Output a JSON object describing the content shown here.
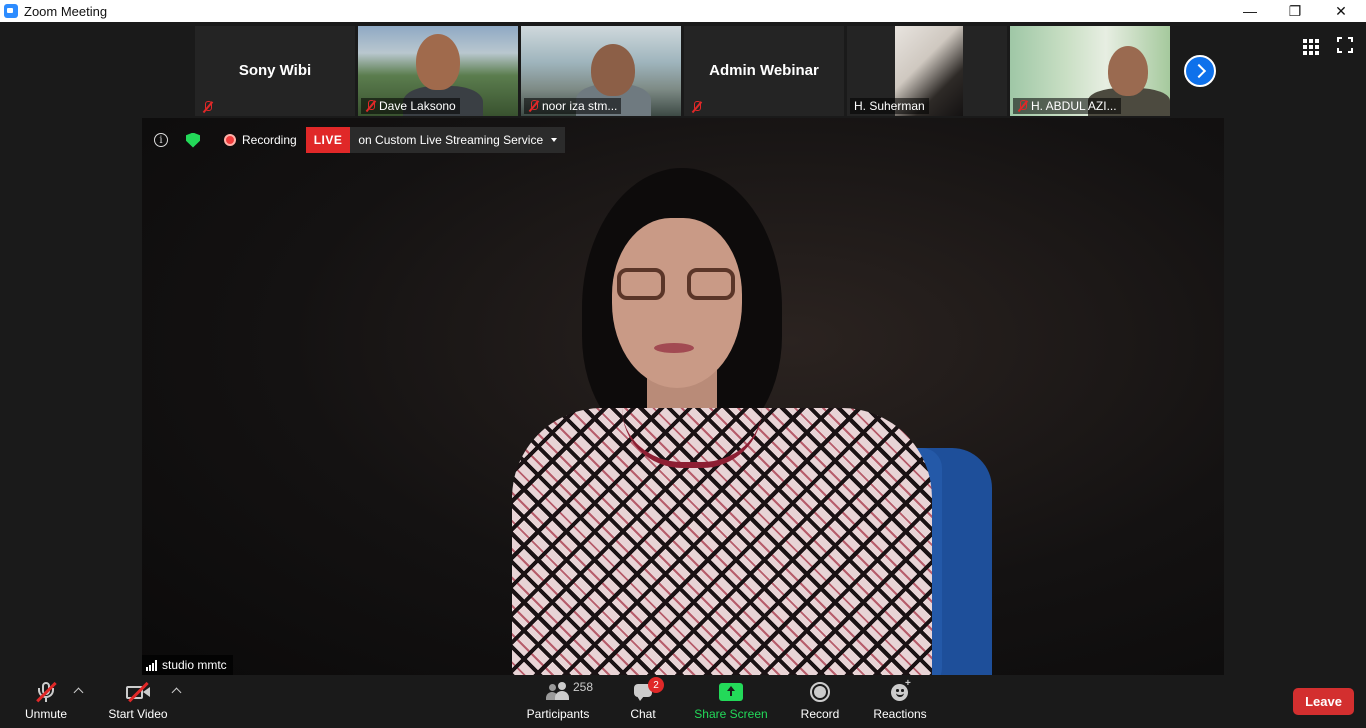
{
  "window": {
    "title": "Zoom Meeting",
    "minimize_glyph": "—",
    "restore_glyph": "❐",
    "close_glyph": "✕"
  },
  "participants_strip": [
    {
      "name": "Sony Wibi",
      "video": false,
      "muted": true
    },
    {
      "name": "Dave Laksono",
      "video": true,
      "muted": true
    },
    {
      "name": "noor iza stm...",
      "video": true,
      "muted": true
    },
    {
      "name": "Admin Webinar",
      "video": false,
      "muted": true
    },
    {
      "name": "H. Suherman",
      "video": true,
      "muted": false
    },
    {
      "name": "H. ABDUL AZI...",
      "video": true,
      "muted": true
    }
  ],
  "info_bar": {
    "info_glyph": "i",
    "recording_label": "Recording",
    "live_badge": "LIVE",
    "live_service": "on Custom Live Streaming Service"
  },
  "active_speaker": {
    "name": "studio mmtc"
  },
  "toolbar": {
    "unmute_label": "Unmute",
    "start_video_label": "Start Video",
    "participants_label": "Participants",
    "participants_count": "258",
    "chat_label": "Chat",
    "chat_badge": "2",
    "share_screen_label": "Share Screen",
    "record_label": "Record",
    "reactions_label": "Reactions",
    "reactions_plus": "+",
    "leave_label": "Leave"
  },
  "colors": {
    "accent_blue": "#0e71eb",
    "live_red": "#e02828",
    "share_green": "#23d959",
    "leave_red": "#d32f2f"
  }
}
